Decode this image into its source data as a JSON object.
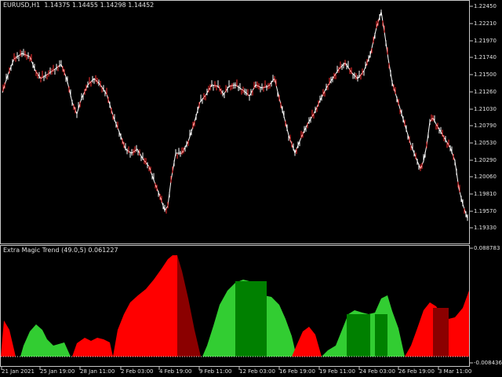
{
  "chart_window": {
    "symbol_label": "EURUSD,H1",
    "ohlc_label": "1.14375  1.14455  1.14298  1.14452",
    "price_scale": [
      "1.22450",
      "1.22210",
      "1.21970",
      "1.21740",
      "1.21500",
      "1.21260",
      "1.21030",
      "1.20790",
      "1.20530",
      "1.20290",
      "1.20060",
      "1.19810",
      "1.19570",
      "1.19330"
    ],
    "indicator": {
      "label": "Extra Magic Trend (49.0,5) 0.061227",
      "scale": [
        "0.088783",
        "-0.008436"
      ]
    },
    "time_scale": [
      "21 Jan 2021",
      "25 Jan 19:00",
      "28 Jan 11:00",
      "2 Feb 03:00",
      "4 Feb 19:00",
      "9 Feb 11:00",
      "12 Feb 03:00",
      "16 Feb 19:00",
      "19 Feb 11:00",
      "24 Feb 03:00",
      "26 Feb 19:00",
      "3 Mar 11:00"
    ],
    "colors": {
      "background": "#000000",
      "frame": "#c8c8c8",
      "text": "#e0e0e0",
      "bull_candle": "#ffffff",
      "bear_candle": "#ff3030",
      "trend_up": "#32cd32",
      "trend_up_dark": "#008000",
      "trend_down": "#ff0000",
      "trend_down_dark": "#8b0000"
    }
  }
}
